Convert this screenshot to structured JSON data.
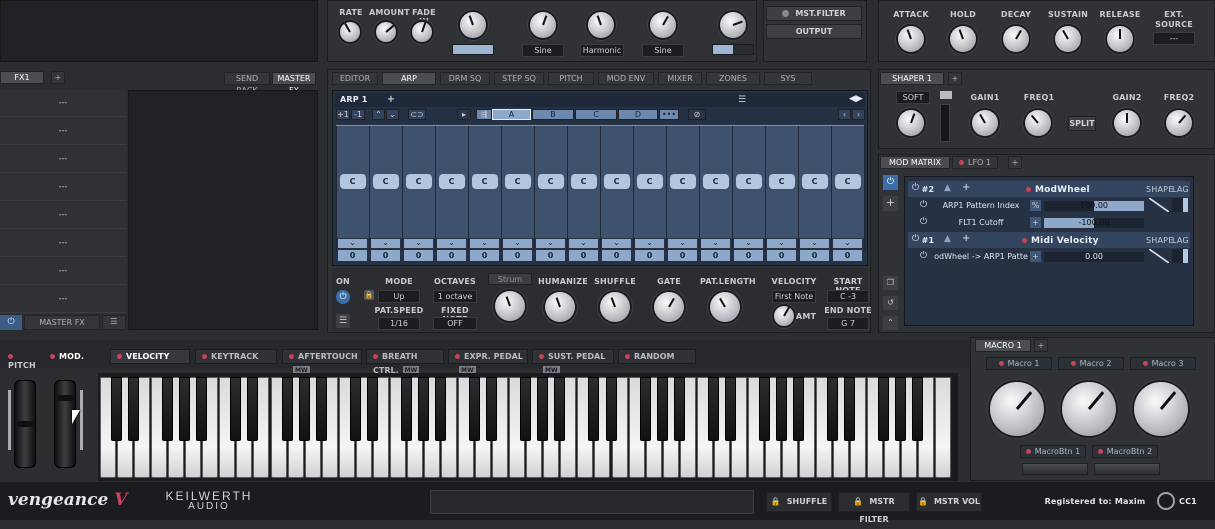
{
  "top": {
    "knob_labels_left": [
      "RATE",
      "AMOUNT",
      "FADE IN"
    ],
    "waveforms": [
      "Sine",
      "Harmonic",
      "Sine"
    ],
    "filter_buttons": {
      "mst_filter": "MST.FILTER",
      "output": "OUTPUT"
    },
    "env_labels": [
      "ATTACK",
      "HOLD",
      "DECAY",
      "SUSTAIN",
      "RELEASE"
    ],
    "ext_source": {
      "label": "EXT. SOURCE",
      "value": "---"
    }
  },
  "fx": {
    "tab": "FX1",
    "add": "+",
    "send_rack": "SEND RACK",
    "master_fx": "MASTER FX",
    "slots": [
      "---",
      "---",
      "---",
      "---",
      "---",
      "---",
      "---",
      "---"
    ],
    "footer_label": "MASTER FX"
  },
  "nav_tabs": [
    "EDITOR",
    "ARP",
    "DRM SQ",
    "STEP SQ",
    "PITCH",
    "MOD ENV",
    "MIXER",
    "ZONES",
    "SYS"
  ],
  "arp": {
    "name": "ARP 1",
    "transpose_up": "+1",
    "transpose_down": "-1",
    "patterns": [
      "A",
      "B",
      "C",
      "D",
      "•••"
    ],
    "notes": [
      "C",
      "C",
      "C",
      "C",
      "C",
      "C",
      "C",
      "C",
      "C",
      "C",
      "C",
      "C",
      "C",
      "C",
      "C",
      "C"
    ],
    "octave_values": [
      "0",
      "0",
      "0",
      "0",
      "0",
      "0",
      "0",
      "0",
      "0",
      "0",
      "0",
      "0",
      "0",
      "0",
      "0",
      "0"
    ],
    "on_label": "ON",
    "mode": {
      "label": "MODE",
      "value": "Up"
    },
    "octaves": {
      "label": "OCTAVES",
      "value": "1 octave"
    },
    "pat_speed": {
      "label": "PAT.SPEED",
      "value": "1/16"
    },
    "fixed_note": {
      "label": "FIXED NOTE",
      "value": "OFF"
    },
    "strum": "Strum",
    "humanize": "HUMANIZE",
    "shuffle": "SHUFFLE",
    "gate": "GATE",
    "pat_length": "PAT.LENGTH",
    "velocity": {
      "label": "VELOCITY",
      "value": "First Note",
      "amt": "AMT"
    },
    "start_note": {
      "label": "START NOTE",
      "value": "C -3"
    },
    "end_note": {
      "label": "END NOTE",
      "value": "G 7"
    }
  },
  "shaper": {
    "tab": "SHAPER 1",
    "soft": "SOFT",
    "gain1": "GAIN1",
    "freq1": "FREQ1",
    "split": "SPLIT",
    "gain2": "GAIN2",
    "freq2": "FREQ2"
  },
  "mod_matrix": {
    "tab": "MOD MATRIX",
    "lfo_tab": "LFO 1",
    "slots": [
      {
        "id": "#2",
        "source": "ModWheel",
        "shape": "SHAPE",
        "lag": "LAG",
        "targets": [
          {
            "name": "ARP1 Pattern Index",
            "unit": "%",
            "value": "100.00",
            "amount": 1.0
          },
          {
            "name": "FLT1 Cutoff",
            "unit": "+",
            "value": "-100.00",
            "amount": -1.0
          }
        ]
      },
      {
        "id": "#1",
        "source": "Midi Velocity",
        "shape": "SHAPE",
        "lag": "LAG",
        "targets": [
          {
            "name": "odWheel -> ARP1 Patte",
            "unit": "+",
            "value": "0.00",
            "amount": 0.0
          }
        ]
      }
    ]
  },
  "controllers": {
    "pitch": "PITCH",
    "mod": "MOD.",
    "sources": [
      {
        "label": "VELOCITY",
        "mw": false
      },
      {
        "label": "KEYTRACK",
        "mw": false
      },
      {
        "label": "AFTERTOUCH",
        "mw": true
      },
      {
        "label": "BREATH CTRL.",
        "mw": true
      },
      {
        "label": "EXPR. PEDAL",
        "mw": true
      },
      {
        "label": "SUST. PEDAL",
        "mw": true
      },
      {
        "label": "RANDOM",
        "mw": false
      }
    ],
    "mw_badge": "MW"
  },
  "macro": {
    "tab": "MACRO 1",
    "knobs": [
      "Macro 1",
      "Macro 2",
      "Macro 3"
    ],
    "buttons": [
      "MacroBtn 1",
      "MacroBtn 2"
    ]
  },
  "footer": {
    "brand": "vengeance",
    "brand_v": "V",
    "company": "KEILWERTH",
    "company_sub": "AUDIO",
    "locks": [
      "SHUFFLE",
      "MSTR FILTER",
      "MSTR VOL"
    ],
    "registered": "Registered to: Maxim",
    "cc": "CC1"
  },
  "colors": {
    "accent": "#b3c6de",
    "led": "#c8425a",
    "power": "#4a8fd8"
  }
}
